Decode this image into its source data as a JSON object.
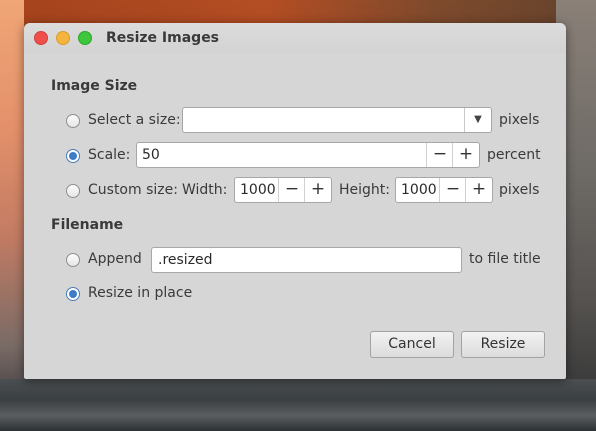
{
  "window": {
    "title": "Resize Images"
  },
  "image_size": {
    "heading": "Image Size",
    "select_size": {
      "label": "Select a size:",
      "value": "",
      "unit": "pixels",
      "selected": false
    },
    "scale": {
      "label": "Scale:",
      "value": "50",
      "unit": "percent",
      "selected": true
    },
    "custom_size": {
      "label": "Custom size:",
      "width_label": "Width:",
      "width_value": "1000",
      "height_label": "Height:",
      "height_value": "1000",
      "unit": "pixels",
      "selected": false
    }
  },
  "filename": {
    "heading": "Filename",
    "append": {
      "label": "Append",
      "value": ".resized",
      "suffix": "to file title",
      "selected": false
    },
    "resize_in_place": {
      "label": "Resize in place",
      "selected": true
    }
  },
  "buttons": {
    "cancel": "Cancel",
    "resize": "Resize"
  },
  "glyphs": {
    "minus": "−",
    "plus": "+",
    "dropdown": "▼"
  },
  "colors": {
    "radio_selected": "#3d7cc9",
    "close": "#ef4e4a",
    "minimize": "#f4b53c",
    "maximize": "#3ec63c"
  }
}
